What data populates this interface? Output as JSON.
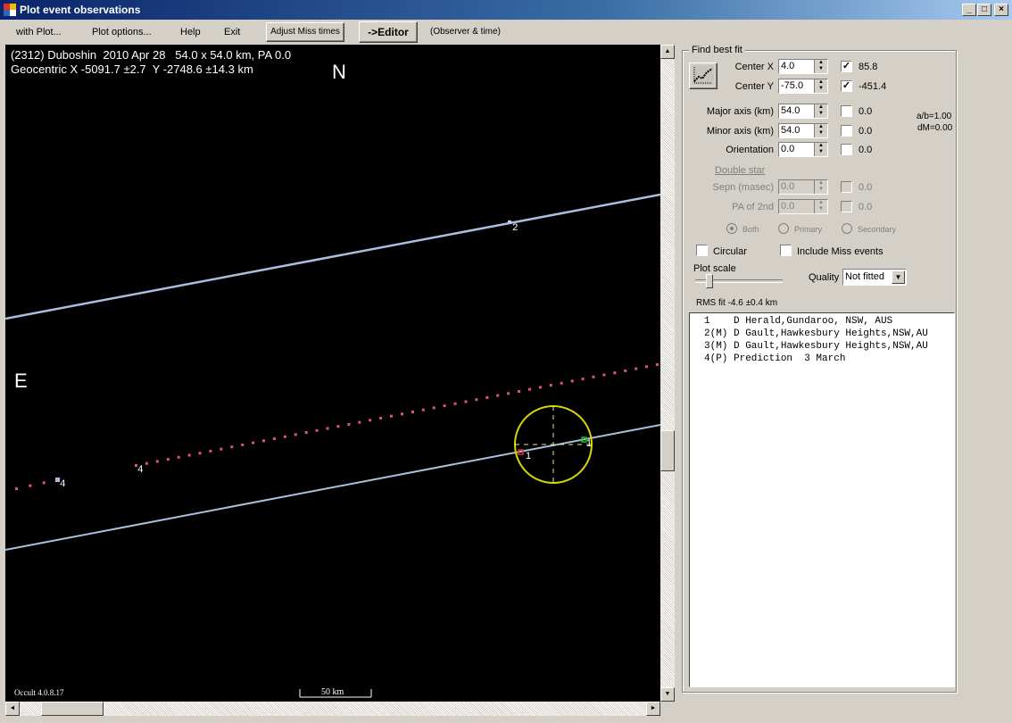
{
  "window": {
    "title": "Plot event observations",
    "controls": {
      "minimize": "_",
      "maximize": "□",
      "close": "×"
    }
  },
  "menu": {
    "items": [
      "with Plot...",
      "Plot options...",
      "Help",
      "Exit"
    ],
    "adjust_miss_times": "Adjust Miss times",
    "editor": "->Editor",
    "observer_time": "(Observer & time)"
  },
  "plot": {
    "header_line1": "(2312) Duboshin  2010 Apr 28   54.0 x 54.0 km, PA 0.0",
    "header_line2": "Geocentric X -5091.7 ±2.7  Y -2748.6 ±14.3 km",
    "north_label": "N",
    "east_label": "E",
    "version": "Occult 4.0.8.17",
    "scale_bar": "50 km",
    "chord_labels": [
      "1",
      "1",
      "2",
      "4",
      "4"
    ],
    "colors": {
      "chord": "#a8c0e0",
      "prediction": "#e0508c",
      "ellipse": "#d8d800",
      "disappear": "#e03030",
      "reappear": "#20c020"
    }
  },
  "fit_panel": {
    "title": "Find best fit",
    "fit_icon": "chart-fit-icon",
    "rows": [
      {
        "label": "Center X",
        "value": "4.0",
        "checked": true,
        "result": "85.8"
      },
      {
        "label": "Center Y",
        "value": "-75.0",
        "checked": true,
        "result": "-451.4"
      },
      {
        "label": "Major axis (km)",
        "value": "54.0",
        "checked": false,
        "result": "0.0"
      },
      {
        "label": "Minor axis (km)",
        "value": "54.0",
        "checked": false,
        "result": "0.0"
      },
      {
        "label": "Orientation",
        "value": "0.0",
        "checked": false,
        "result": "0.0"
      }
    ],
    "ratio": "a/b=1.00",
    "dm": "dM=0.00",
    "double_star": {
      "title": "Double star",
      "rows": [
        {
          "label": "Sepn (masec)",
          "value": "0.0",
          "result": "0.0"
        },
        {
          "label": "PA of 2nd",
          "value": "0.0",
          "result": "0.0"
        }
      ],
      "radios": [
        "Both",
        "Primary",
        "Secondary"
      ]
    },
    "circular": "Circular",
    "include_miss": "Include Miss events",
    "plot_scale": "Plot scale",
    "quality_label": "Quality",
    "quality_value": "Not fitted",
    "rms": "RMS fit -4.6 ±0.4 km"
  },
  "observations": [
    "1    D Herald,Gundaroo, NSW, AUS",
    "2(M) D Gault,Hawkesbury Heights,NSW,AU",
    "3(M) D Gault,Hawkesbury Heights,NSW,AU",
    "4(P) Prediction  3 March"
  ]
}
